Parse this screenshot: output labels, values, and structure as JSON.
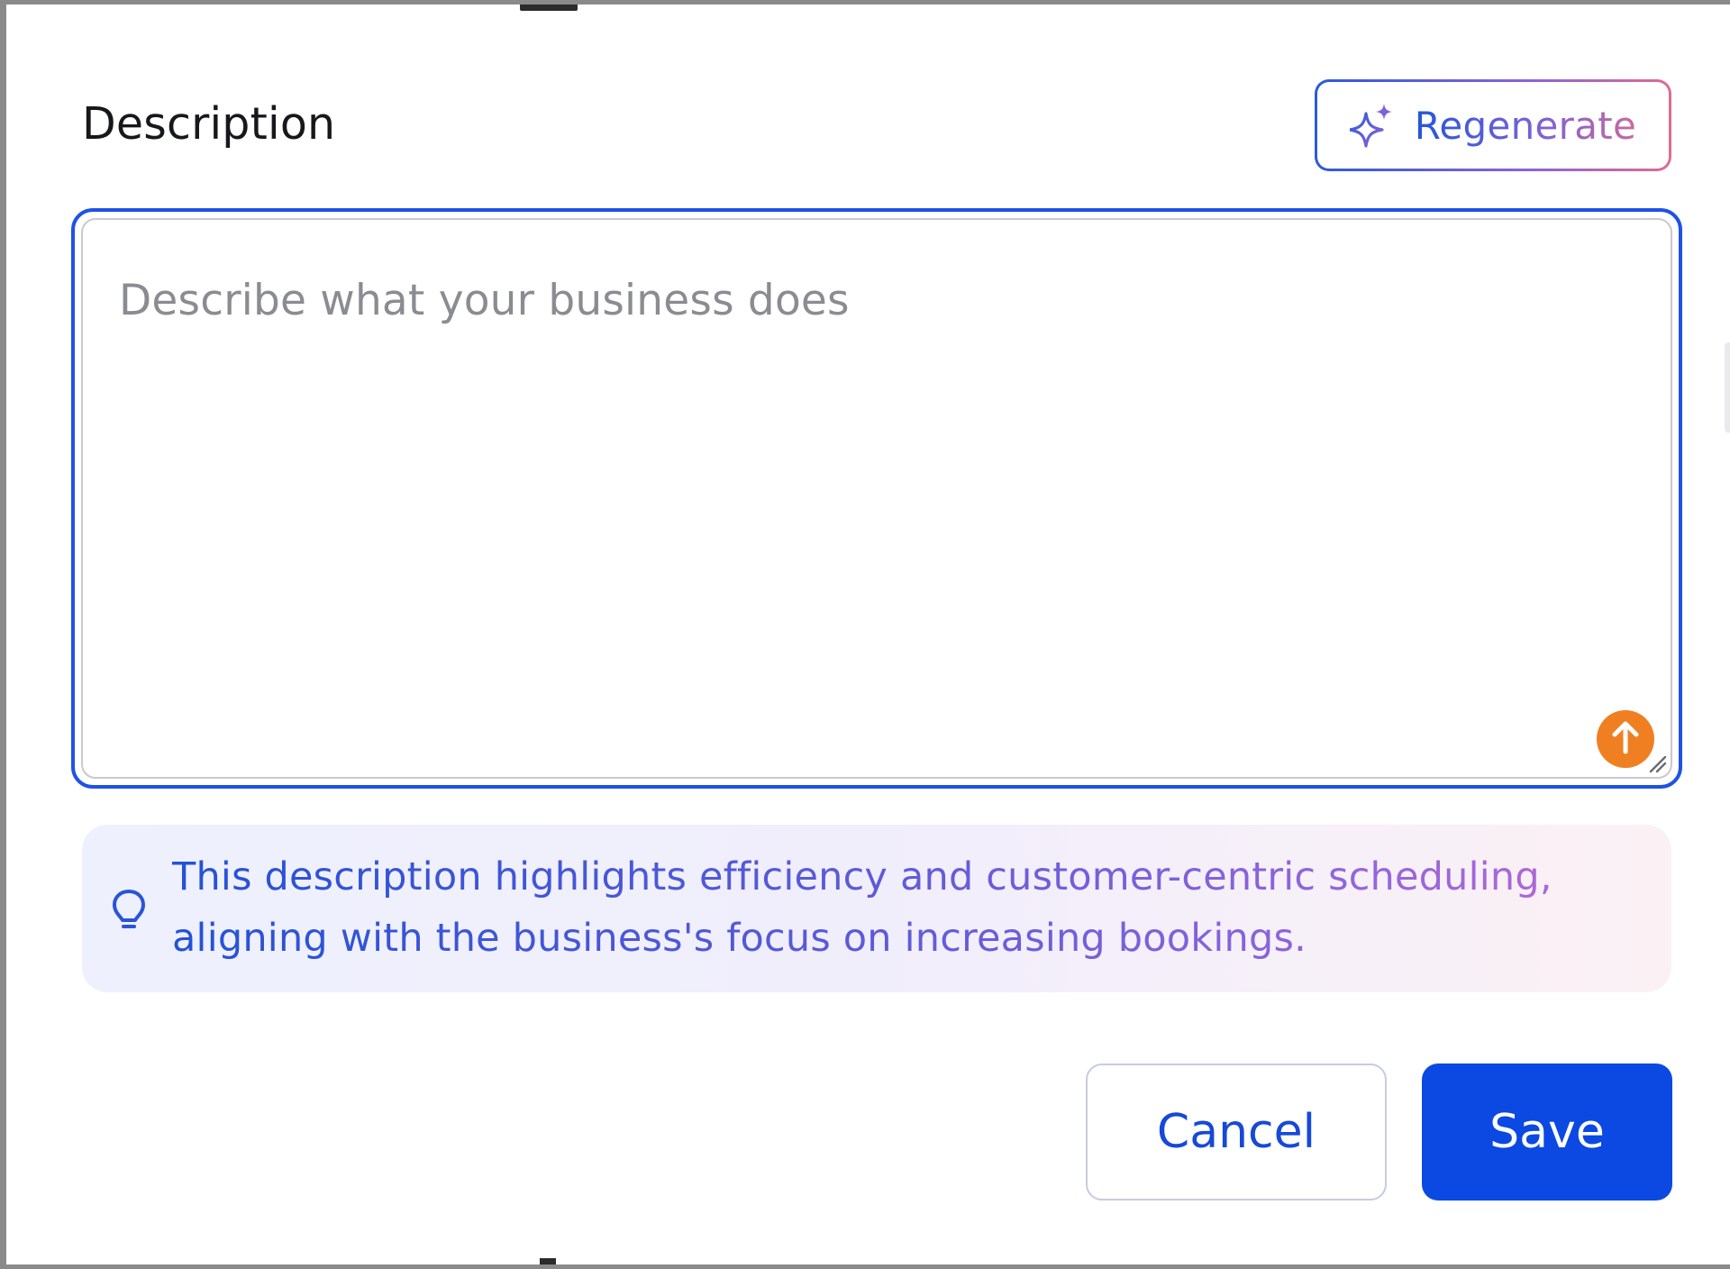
{
  "header": {
    "title": "Description",
    "regenerate_label": "Regenerate",
    "regenerate_icon": "sparkle-icon"
  },
  "description_field": {
    "value": "",
    "placeholder": "Describe what your business does",
    "upload_icon": "arrow-up-icon",
    "resize_icon": "resize-handle-icon"
  },
  "hint": {
    "icon": "lightbulb-icon",
    "text": "This description highlights efficiency and customer-centric scheduling, aligning with the business's focus on increasing bookings."
  },
  "actions": {
    "cancel_label": "Cancel",
    "save_label": "Save"
  },
  "colors": {
    "accent": "#0b49e2",
    "focus_border": "#1f52e6",
    "upload_button": "#f07f22",
    "regenerate_gradient_start": "#2b5bd8",
    "regenerate_gradient_end": "#df6c92"
  }
}
